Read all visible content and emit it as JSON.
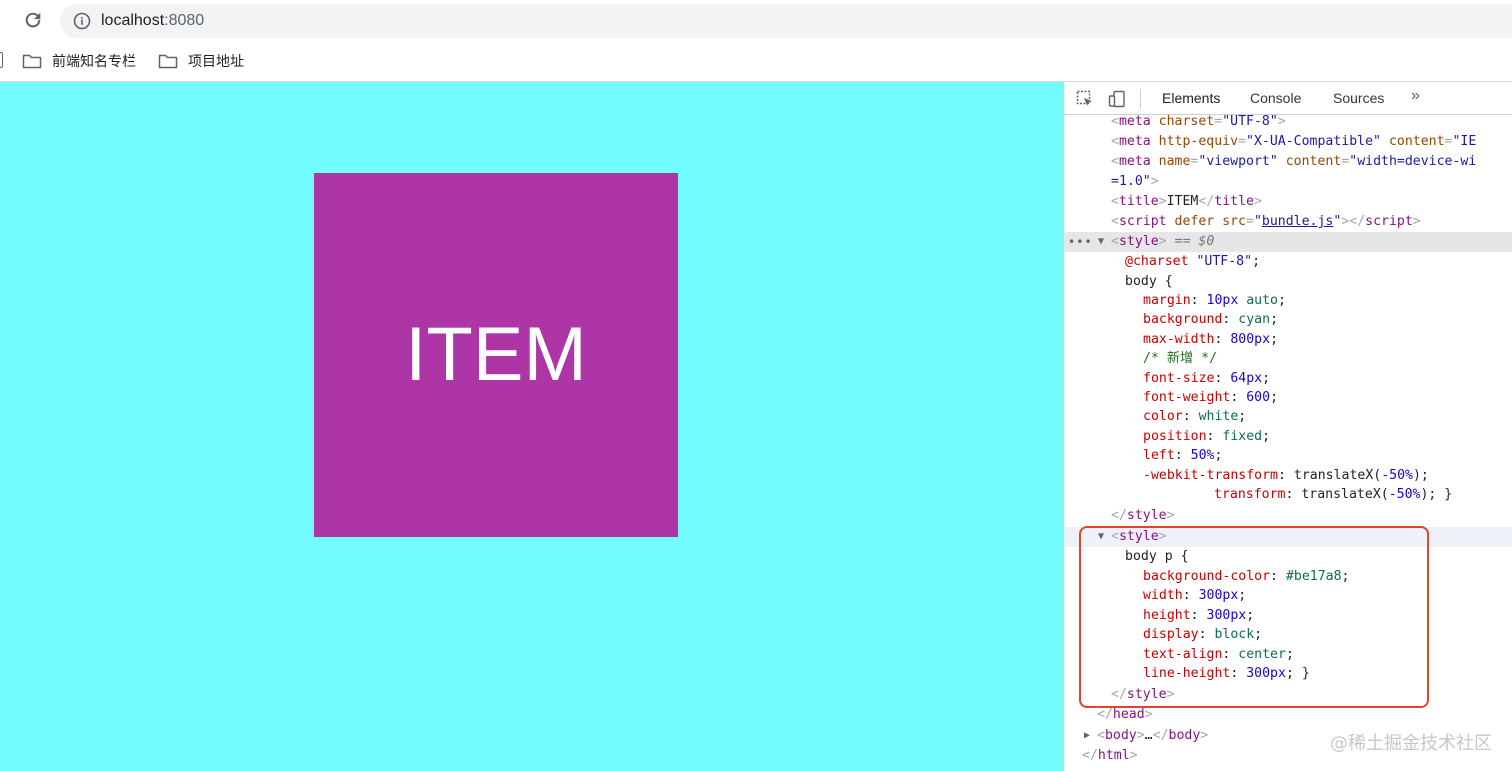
{
  "browser": {
    "url_host": "localhost",
    "url_port": ":8080",
    "bookmarks": [
      "前端知名专栏",
      "项目地址"
    ]
  },
  "page": {
    "item_text": "ITEM",
    "background_color": "#72fcfc",
    "box_color": "#ad35a6"
  },
  "devtools": {
    "tabs": [
      "Elements",
      "Console",
      "Sources"
    ],
    "more_label": "»",
    "selected_marker": "== $0",
    "lines": {
      "l1": {
        "t1": "<",
        "tag": "meta",
        "a1": " charset",
        "e": "=",
        "v1": "\"UTF-8\"",
        "t2": ">"
      },
      "l2": {
        "t1": "<",
        "tag": "meta",
        "a1": " http-equiv",
        "e1": "=",
        "v1": "\"X-UA-Compatible\"",
        "a2": " content",
        "e2": "=",
        "v2": "\"IE"
      },
      "l3": {
        "t1": "<",
        "tag": "meta",
        "a1": " name",
        "e1": "=",
        "v1": "\"viewport\"",
        "a2": " content",
        "e2": "=",
        "v2": "\"width=device-wi"
      },
      "l4": {
        "v": "=1.0\"",
        "t2": ">"
      },
      "l5": {
        "t1": "<",
        "tag": "title",
        "t2": ">",
        "text": "ITEM",
        "t3": "</",
        "tag2": "title",
        "t4": ">"
      },
      "l6": {
        "t1": "<",
        "tag": "script",
        "a1": " defer",
        "a2": " src",
        "e": "=",
        "q1": "\"",
        "link": "bundle.js",
        "q2": "\"",
        "t2": "></",
        "tag2": "script",
        "t3": ">"
      },
      "l7": {
        "t1": "<",
        "tag": "style",
        "t2": ">"
      },
      "l8": {
        "kw": "@charset",
        "str": "\"UTF-8\"",
        "end": ";"
      },
      "l9": {
        "sel": "body {"
      },
      "l10": {
        "p": "margin",
        "v": "10px",
        "v2": " auto"
      },
      "l11": {
        "p": "background",
        "v": "cyan"
      },
      "l12": {
        "p": "max-width",
        "v": "800px"
      },
      "l13": {
        "c": "/* 新增 */"
      },
      "l14": {
        "p": "font-size",
        "v": "64px"
      },
      "l15": {
        "p": "font-weight",
        "v": "600"
      },
      "l16": {
        "p": "color",
        "v": "white"
      },
      "l17": {
        "p": "position",
        "v": "fixed"
      },
      "l18": {
        "p": "left",
        "v": "50%"
      },
      "l19": {
        "p": "-webkit-transform",
        "fn": "translateX(",
        "v": "-50%",
        "end": ");"
      },
      "l20": {
        "p": "transform",
        "fn": "translateX(",
        "v": "-50%",
        "end": "); }"
      },
      "l21": {
        "t1": "</",
        "tag": "style",
        "t2": ">"
      },
      "l22": {
        "t1": "<",
        "tag": "style",
        "t2": ">"
      },
      "l23": {
        "sel": "body p {"
      },
      "l24": {
        "p": "background-color",
        "v": "#be17a8"
      },
      "l25": {
        "p": "width",
        "v": "300px"
      },
      "l26": {
        "p": "height",
        "v": "300px"
      },
      "l27": {
        "p": "display",
        "v": "block"
      },
      "l28": {
        "p": "text-align",
        "v": "center"
      },
      "l29": {
        "p": "line-height",
        "v": "300px",
        "end": "; }"
      },
      "l30": {
        "t1": "</",
        "tag": "style",
        "t2": ">"
      },
      "l31": {
        "t1": "</",
        "tag": "head",
        "t2": ">"
      },
      "l32": {
        "t1": "<",
        "tag": "body",
        "t2": ">",
        "ell": "…",
        "t3": "</",
        "tag2": "body",
        "t4": ">"
      },
      "l33": {
        "t1": "</",
        "tag": "html",
        "t2": ">"
      }
    }
  },
  "watermark": "@稀土掘金技术社区"
}
